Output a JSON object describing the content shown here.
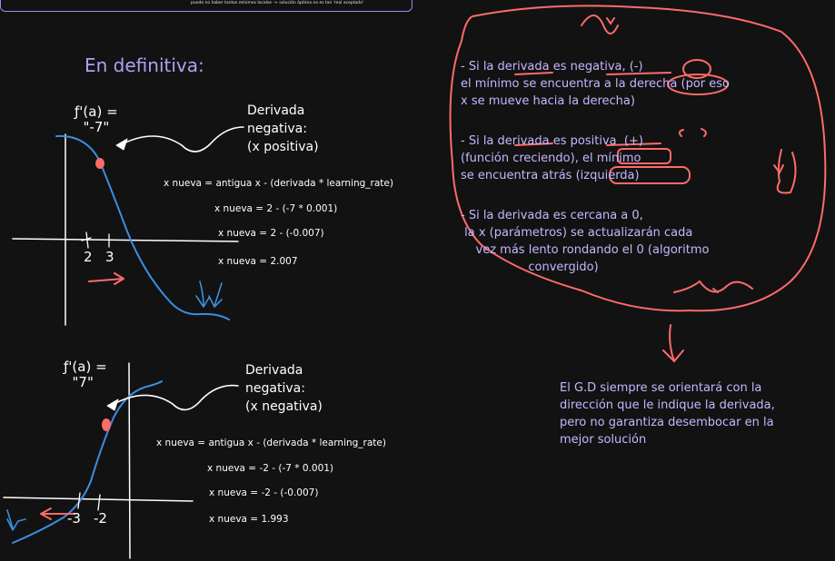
{
  "top_note": "puede no haber tantos mínimos locales -> solución óptima no es tan 'mal aceptada'",
  "heading": "En definitiva:",
  "graph1": {
    "fx_label": "ƒ'(a) =\n  \"-7\"",
    "annotation": "Derivada\nnegativa:\n(x positiva)",
    "ticks": [
      "2",
      "3"
    ],
    "equations": [
      "x nueva = antigua x - (derivada * learning_rate)",
      "x nueva = 2 - (-7 * 0.001)",
      "x nueva = 2 - (-0.007)",
      "x nueva = 2.007"
    ]
  },
  "graph2": {
    "fx_label": "ƒ'(a) =\n  \"7\"",
    "annotation": "Derivada\nnegativa:\n(x negativa)",
    "ticks": [
      "-3",
      "-2"
    ],
    "equations": [
      "x nueva = antigua x - (derivada * learning_rate)",
      "x nueva = -2 - (-7 * 0.001)",
      "x nueva = -2 - (-0.007)",
      "x nueva = 1.993"
    ]
  },
  "bubble": {
    "p1": "- Si la derivada es negativa, (-)\nel mínimo se encuentra a la derecha (por eso\nx se mueve hacia la derecha)",
    "p2": "- Si la derivada es positiva  (+)\n(función creciendo), el mínimo\nse encuentra atrás (izquierda)",
    "p3": "- Si la derivada es cercana a 0,\n la x (parámetros) se actualizarán cada\n    vez más lento rondando el 0 (algoritmo\n                  convergido)"
  },
  "conclusion": "El G.D siempre se orientará con la dirección que le indique la derivada, pero no garantiza desembocar en la mejor solución",
  "colors": {
    "purple": "#c6b6ff",
    "red": "#ff6b6b",
    "blue": "#3a8fe0",
    "white": "#ffffff"
  }
}
